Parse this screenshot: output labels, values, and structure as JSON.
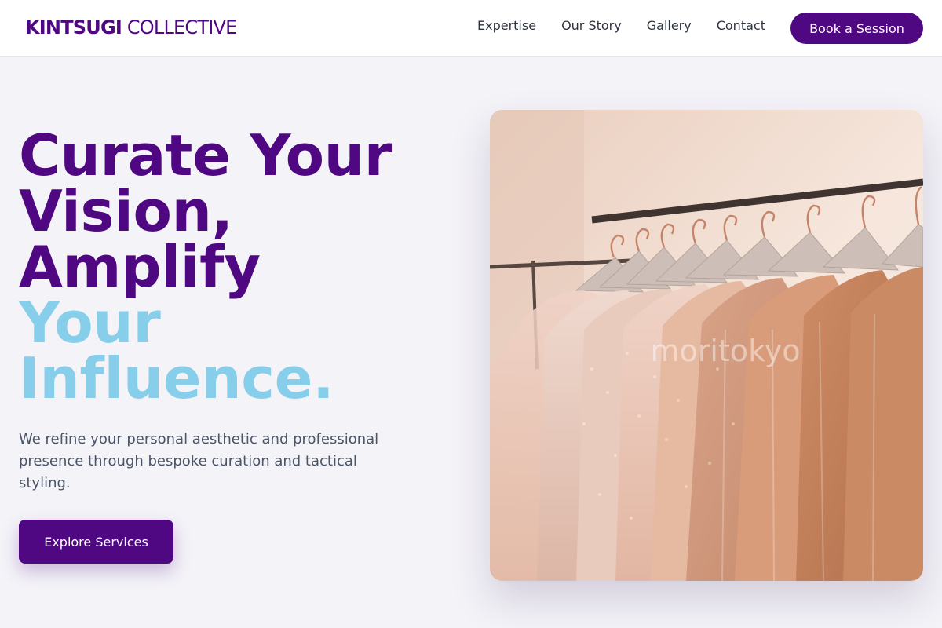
{
  "brand": {
    "name_bold": "KINTSUGI",
    "name_light": "COLLECTIVE"
  },
  "nav": {
    "links": [
      "Expertise",
      "Our Story",
      "Gallery",
      "Contact"
    ],
    "cta": "Book a Session"
  },
  "hero": {
    "headline_primary": [
      "Curate Your",
      "Vision,",
      "Amplify"
    ],
    "headline_accent": [
      "Your",
      "Influence."
    ],
    "subtext": "We refine your personal aesthetic and professional presence through bespoke curation and tactical styling.",
    "cta": "Explore Services",
    "image": {
      "watermark": "moritokyo"
    }
  },
  "colors": {
    "primary": "#4f0882",
    "accent": "#87ceeb",
    "background": "#f4f3f8",
    "body_text": "#4a5568"
  }
}
